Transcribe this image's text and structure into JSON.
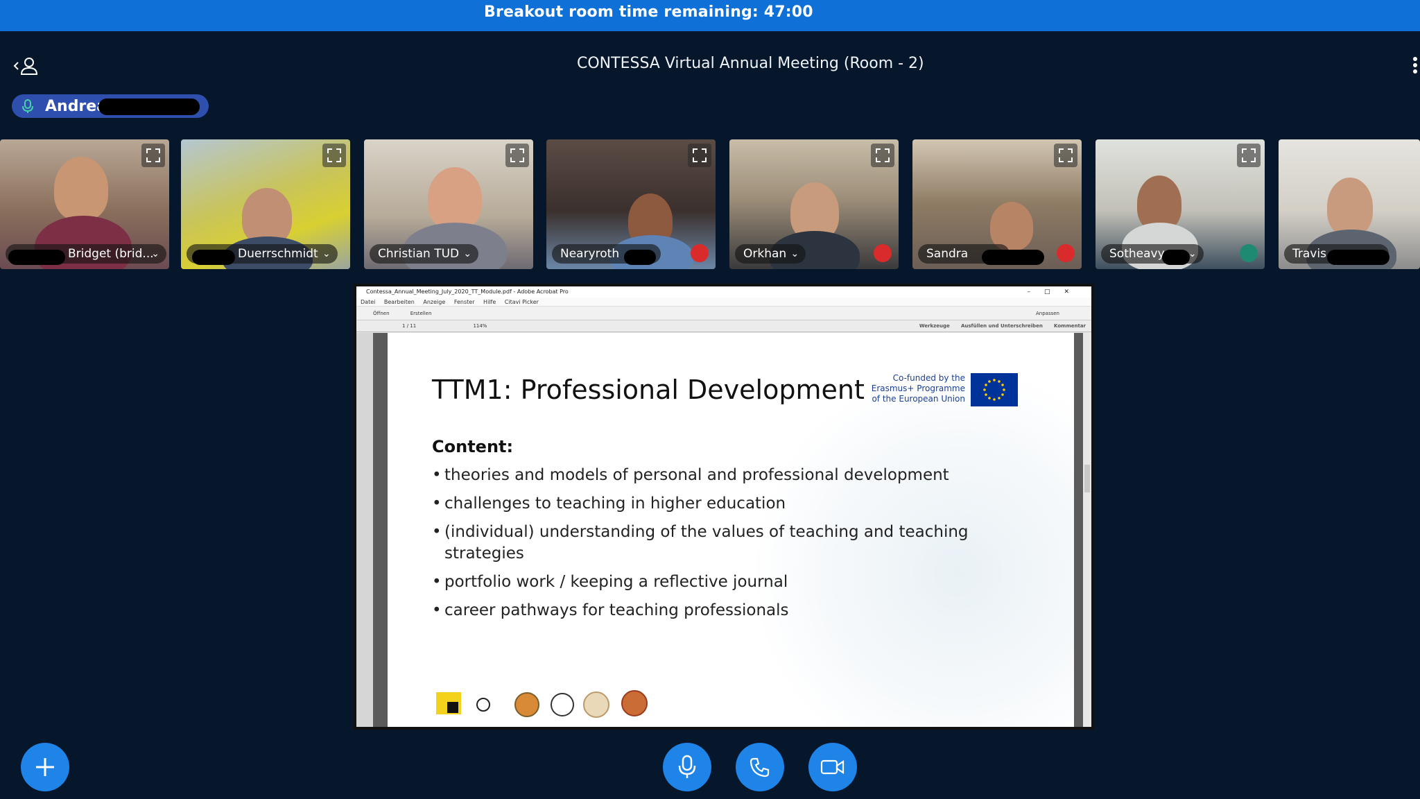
{
  "banner": {
    "text": "Breakout room time remaining: 47:00"
  },
  "header": {
    "title": "CONTESSA Virtual Annual Meeting (Room - 2)"
  },
  "presenter": {
    "name": "Andreas",
    "mic": "mic-icon"
  },
  "participants": [
    {
      "name": "Bridget (brid...",
      "state": "normal"
    },
    {
      "name": "Duerrschmidt",
      "state": "normal"
    },
    {
      "name": "Christian TUD",
      "state": "normal"
    },
    {
      "name": "Nearyroth",
      "state": "muted"
    },
    {
      "name": "Orkhan",
      "state": "muted"
    },
    {
      "name": "Sandra",
      "state": "muted"
    },
    {
      "name": "Sotheavy",
      "state": "listening"
    },
    {
      "name": "Travis",
      "state": "normal"
    }
  ],
  "acrobat": {
    "window_title": "Contessa_Annual_Meeting_July_2020_TT_Module.pdf - Adobe Acrobat Pro",
    "menu": [
      "Datei",
      "Bearbeiten",
      "Anzeige",
      "Fenster",
      "Hilfe",
      "Citavi Picker"
    ],
    "toolbar": {
      "open": "Öffnen",
      "create": "Erstellen",
      "customize": "Anpassen"
    },
    "page": "1",
    "pages": "/ 11",
    "zoom": "114%",
    "panels": [
      "Werkzeuge",
      "Ausfüllen und Unterschreiben",
      "Kommentar"
    ]
  },
  "slide": {
    "title": "TTM1: Professional Development",
    "eu_text": "Co-funded by the Erasmus+ Programme of the European Union",
    "content_label": "Content:",
    "bullets": [
      "theories and models of personal and professional development",
      "challenges to teaching in higher education",
      "(individual) understanding of the values of teaching and teaching strategies",
      "portfolio work / keeping a reflective journal",
      "career pathways for teaching professionals"
    ]
  },
  "controls": [
    "mic-icon",
    "phone-icon",
    "video-icon"
  ],
  "colors": {
    "banner": "#0f70d7",
    "background": "#06172c",
    "button": "#1f84e8",
    "muted": "#d92b2b",
    "pill": "#2f4fae"
  }
}
